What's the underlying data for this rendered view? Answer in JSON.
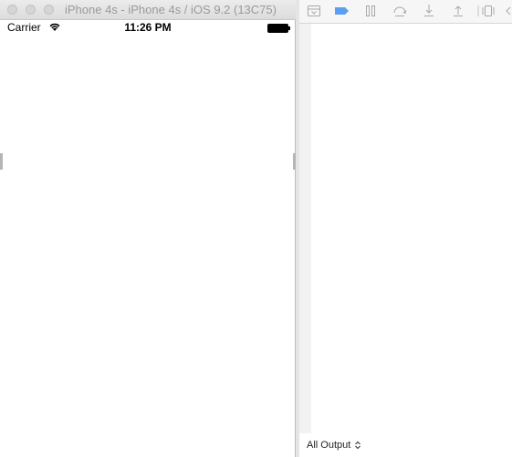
{
  "simulator": {
    "title": "iPhone 4s - iPhone 4s / iOS 9.2 (13C75)",
    "status_bar": {
      "carrier": "Carrier",
      "time": "11:26 PM"
    }
  },
  "debug_area": {
    "toolbar_icons": [
      "hide-debug-area-icon",
      "breakpoint-icon",
      "pause-icon",
      "step-over-icon",
      "step-into-icon",
      "step-out-icon",
      "view-hierarchy-icon"
    ],
    "output_filter": "All Output"
  },
  "colors": {
    "breakpoint_active": "#5a9ff0",
    "toolbar_icon": "#a8a8a8"
  }
}
